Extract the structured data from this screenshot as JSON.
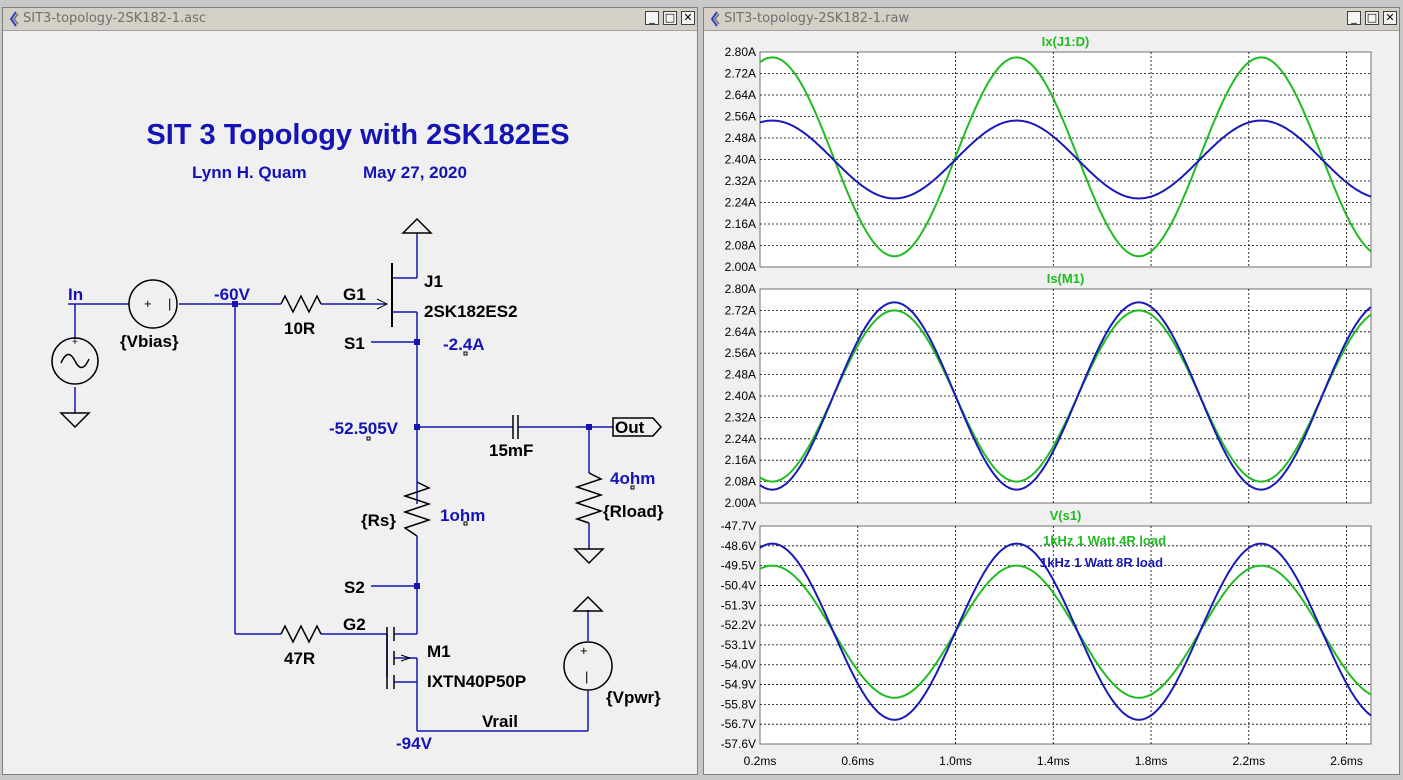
{
  "schematic_window": {
    "title": "SIT3-topology-2SK182-1.asc",
    "heading": "SIT 3 Topology with 2SK182ES",
    "author": "Lynn H. Quam",
    "date": "May 27, 2020",
    "labels": {
      "in": "In",
      "vbias": "{Vbias}",
      "node_bias": "-60V",
      "r_gate1": "10R",
      "g1": "G1",
      "j1": "J1",
      "j1_part": "2SK182ES2",
      "s1": "S1",
      "current_s1": "-2.4A",
      "node_out": "-52.505V",
      "cap": "15mF",
      "out": "Out",
      "rload_val": "4ohm",
      "rload": "{Rload}",
      "rs": "{Rs}",
      "rs_val": "1ohm",
      "s2": "S2",
      "g2": "G2",
      "r_gate2": "47R",
      "m1": "M1",
      "m1_part": "IXTN40P50P",
      "vpwr": "{Vpwr}",
      "vrail": "Vrail",
      "node_rail": "-94V"
    }
  },
  "waveform_window": {
    "title": "SIT3-topology-2SK182-1.raw",
    "x_ticks": [
      "0.2ms",
      "0.6ms",
      "1.0ms",
      "1.4ms",
      "1.8ms",
      "2.2ms",
      "2.6ms"
    ],
    "annotation_4r": "1kHz 1 Watt 4R load",
    "annotation_8r": "1kHz 1 Watt 8R load"
  },
  "colors": {
    "trace_4r": "#22bb22",
    "trace_8r": "#1a1ab8",
    "schematic_label": "#1414b4",
    "wire": "#1414b4"
  },
  "chart_data": [
    {
      "type": "line",
      "title": "Ix(J1:D)",
      "xlabel": "",
      "ylabel": "",
      "xlim": [
        0.2,
        2.7
      ],
      "ylim": [
        2.0,
        2.8
      ],
      "yticks": [
        "2.80A",
        "2.72A",
        "2.64A",
        "2.56A",
        "2.48A",
        "2.40A",
        "2.32A",
        "2.24A",
        "2.16A",
        "2.08A",
        "2.00A"
      ],
      "grid": true,
      "period_ms": 1.0,
      "series": [
        {
          "color": "#22bb22",
          "offset": 2.41,
          "amplitude": 0.37,
          "peak_at_ms": 0.25
        },
        {
          "color": "#1a1ab8",
          "offset": 2.4,
          "amplitude": 0.145,
          "peak_at_ms": 0.25
        }
      ]
    },
    {
      "type": "line",
      "title": "Is(M1)",
      "xlabel": "",
      "ylabel": "",
      "xlim": [
        0.2,
        2.7
      ],
      "ylim": [
        2.0,
        2.8
      ],
      "yticks": [
        "2.80A",
        "2.72A",
        "2.64A",
        "2.56A",
        "2.48A",
        "2.40A",
        "2.32A",
        "2.24A",
        "2.16A",
        "2.08A",
        "2.00A"
      ],
      "grid": true,
      "period_ms": 1.0,
      "series": [
        {
          "color": "#22bb22",
          "offset": 2.4,
          "amplitude": 0.32,
          "peak_at_ms": 0.75
        },
        {
          "color": "#1a1ab8",
          "offset": 2.4,
          "amplitude": 0.35,
          "peak_at_ms": 0.75
        }
      ]
    },
    {
      "type": "line",
      "title": "V(s1)",
      "xlabel": "",
      "ylabel": "",
      "xlim": [
        0.2,
        2.7
      ],
      "ylim": [
        -57.6,
        -47.7
      ],
      "yticks": [
        "-47.7V",
        "-48.6V",
        "-49.5V",
        "-50.4V",
        "-51.3V",
        "-52.2V",
        "-53.1V",
        "-54.0V",
        "-54.9V",
        "-55.8V",
        "-56.7V",
        "-57.6V"
      ],
      "grid": true,
      "period_ms": 1.0,
      "series": [
        {
          "color": "#22bb22",
          "offset": -52.5,
          "amplitude": 3.0,
          "peak_at_ms": 0.25
        },
        {
          "color": "#1a1ab8",
          "offset": -52.5,
          "amplitude": 4.0,
          "peak_at_ms": 0.25
        }
      ]
    }
  ]
}
